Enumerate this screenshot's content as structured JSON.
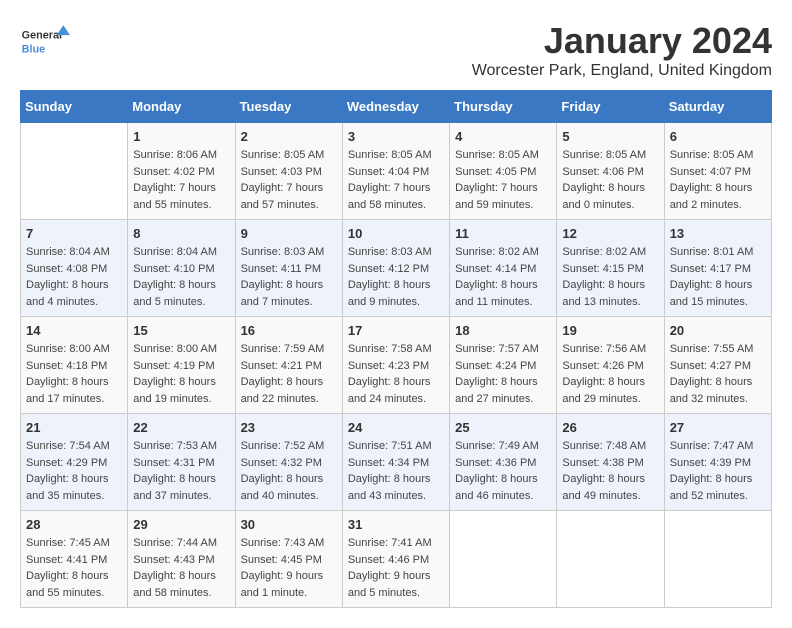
{
  "logo": {
    "general": "General",
    "blue": "Blue"
  },
  "title": "January 2024",
  "subtitle": "Worcester Park, England, United Kingdom",
  "days_header": [
    "Sunday",
    "Monday",
    "Tuesday",
    "Wednesday",
    "Thursday",
    "Friday",
    "Saturday"
  ],
  "weeks": [
    [
      {
        "day": "",
        "info": ""
      },
      {
        "day": "1",
        "info": "Sunrise: 8:06 AM\nSunset: 4:02 PM\nDaylight: 7 hours\nand 55 minutes."
      },
      {
        "day": "2",
        "info": "Sunrise: 8:05 AM\nSunset: 4:03 PM\nDaylight: 7 hours\nand 57 minutes."
      },
      {
        "day": "3",
        "info": "Sunrise: 8:05 AM\nSunset: 4:04 PM\nDaylight: 7 hours\nand 58 minutes."
      },
      {
        "day": "4",
        "info": "Sunrise: 8:05 AM\nSunset: 4:05 PM\nDaylight: 7 hours\nand 59 minutes."
      },
      {
        "day": "5",
        "info": "Sunrise: 8:05 AM\nSunset: 4:06 PM\nDaylight: 8 hours\nand 0 minutes."
      },
      {
        "day": "6",
        "info": "Sunrise: 8:05 AM\nSunset: 4:07 PM\nDaylight: 8 hours\nand 2 minutes."
      }
    ],
    [
      {
        "day": "7",
        "info": "Sunrise: 8:04 AM\nSunset: 4:08 PM\nDaylight: 8 hours\nand 4 minutes."
      },
      {
        "day": "8",
        "info": "Sunrise: 8:04 AM\nSunset: 4:10 PM\nDaylight: 8 hours\nand 5 minutes."
      },
      {
        "day": "9",
        "info": "Sunrise: 8:03 AM\nSunset: 4:11 PM\nDaylight: 8 hours\nand 7 minutes."
      },
      {
        "day": "10",
        "info": "Sunrise: 8:03 AM\nSunset: 4:12 PM\nDaylight: 8 hours\nand 9 minutes."
      },
      {
        "day": "11",
        "info": "Sunrise: 8:02 AM\nSunset: 4:14 PM\nDaylight: 8 hours\nand 11 minutes."
      },
      {
        "day": "12",
        "info": "Sunrise: 8:02 AM\nSunset: 4:15 PM\nDaylight: 8 hours\nand 13 minutes."
      },
      {
        "day": "13",
        "info": "Sunrise: 8:01 AM\nSunset: 4:17 PM\nDaylight: 8 hours\nand 15 minutes."
      }
    ],
    [
      {
        "day": "14",
        "info": "Sunrise: 8:00 AM\nSunset: 4:18 PM\nDaylight: 8 hours\nand 17 minutes."
      },
      {
        "day": "15",
        "info": "Sunrise: 8:00 AM\nSunset: 4:19 PM\nDaylight: 8 hours\nand 19 minutes."
      },
      {
        "day": "16",
        "info": "Sunrise: 7:59 AM\nSunset: 4:21 PM\nDaylight: 8 hours\nand 22 minutes."
      },
      {
        "day": "17",
        "info": "Sunrise: 7:58 AM\nSunset: 4:23 PM\nDaylight: 8 hours\nand 24 minutes."
      },
      {
        "day": "18",
        "info": "Sunrise: 7:57 AM\nSunset: 4:24 PM\nDaylight: 8 hours\nand 27 minutes."
      },
      {
        "day": "19",
        "info": "Sunrise: 7:56 AM\nSunset: 4:26 PM\nDaylight: 8 hours\nand 29 minutes."
      },
      {
        "day": "20",
        "info": "Sunrise: 7:55 AM\nSunset: 4:27 PM\nDaylight: 8 hours\nand 32 minutes."
      }
    ],
    [
      {
        "day": "21",
        "info": "Sunrise: 7:54 AM\nSunset: 4:29 PM\nDaylight: 8 hours\nand 35 minutes."
      },
      {
        "day": "22",
        "info": "Sunrise: 7:53 AM\nSunset: 4:31 PM\nDaylight: 8 hours\nand 37 minutes."
      },
      {
        "day": "23",
        "info": "Sunrise: 7:52 AM\nSunset: 4:32 PM\nDaylight: 8 hours\nand 40 minutes."
      },
      {
        "day": "24",
        "info": "Sunrise: 7:51 AM\nSunset: 4:34 PM\nDaylight: 8 hours\nand 43 minutes."
      },
      {
        "day": "25",
        "info": "Sunrise: 7:49 AM\nSunset: 4:36 PM\nDaylight: 8 hours\nand 46 minutes."
      },
      {
        "day": "26",
        "info": "Sunrise: 7:48 AM\nSunset: 4:38 PM\nDaylight: 8 hours\nand 49 minutes."
      },
      {
        "day": "27",
        "info": "Sunrise: 7:47 AM\nSunset: 4:39 PM\nDaylight: 8 hours\nand 52 minutes."
      }
    ],
    [
      {
        "day": "28",
        "info": "Sunrise: 7:45 AM\nSunset: 4:41 PM\nDaylight: 8 hours\nand 55 minutes."
      },
      {
        "day": "29",
        "info": "Sunrise: 7:44 AM\nSunset: 4:43 PM\nDaylight: 8 hours\nand 58 minutes."
      },
      {
        "day": "30",
        "info": "Sunrise: 7:43 AM\nSunset: 4:45 PM\nDaylight: 9 hours\nand 1 minute."
      },
      {
        "day": "31",
        "info": "Sunrise: 7:41 AM\nSunset: 4:46 PM\nDaylight: 9 hours\nand 5 minutes."
      },
      {
        "day": "",
        "info": ""
      },
      {
        "day": "",
        "info": ""
      },
      {
        "day": "",
        "info": ""
      }
    ]
  ]
}
